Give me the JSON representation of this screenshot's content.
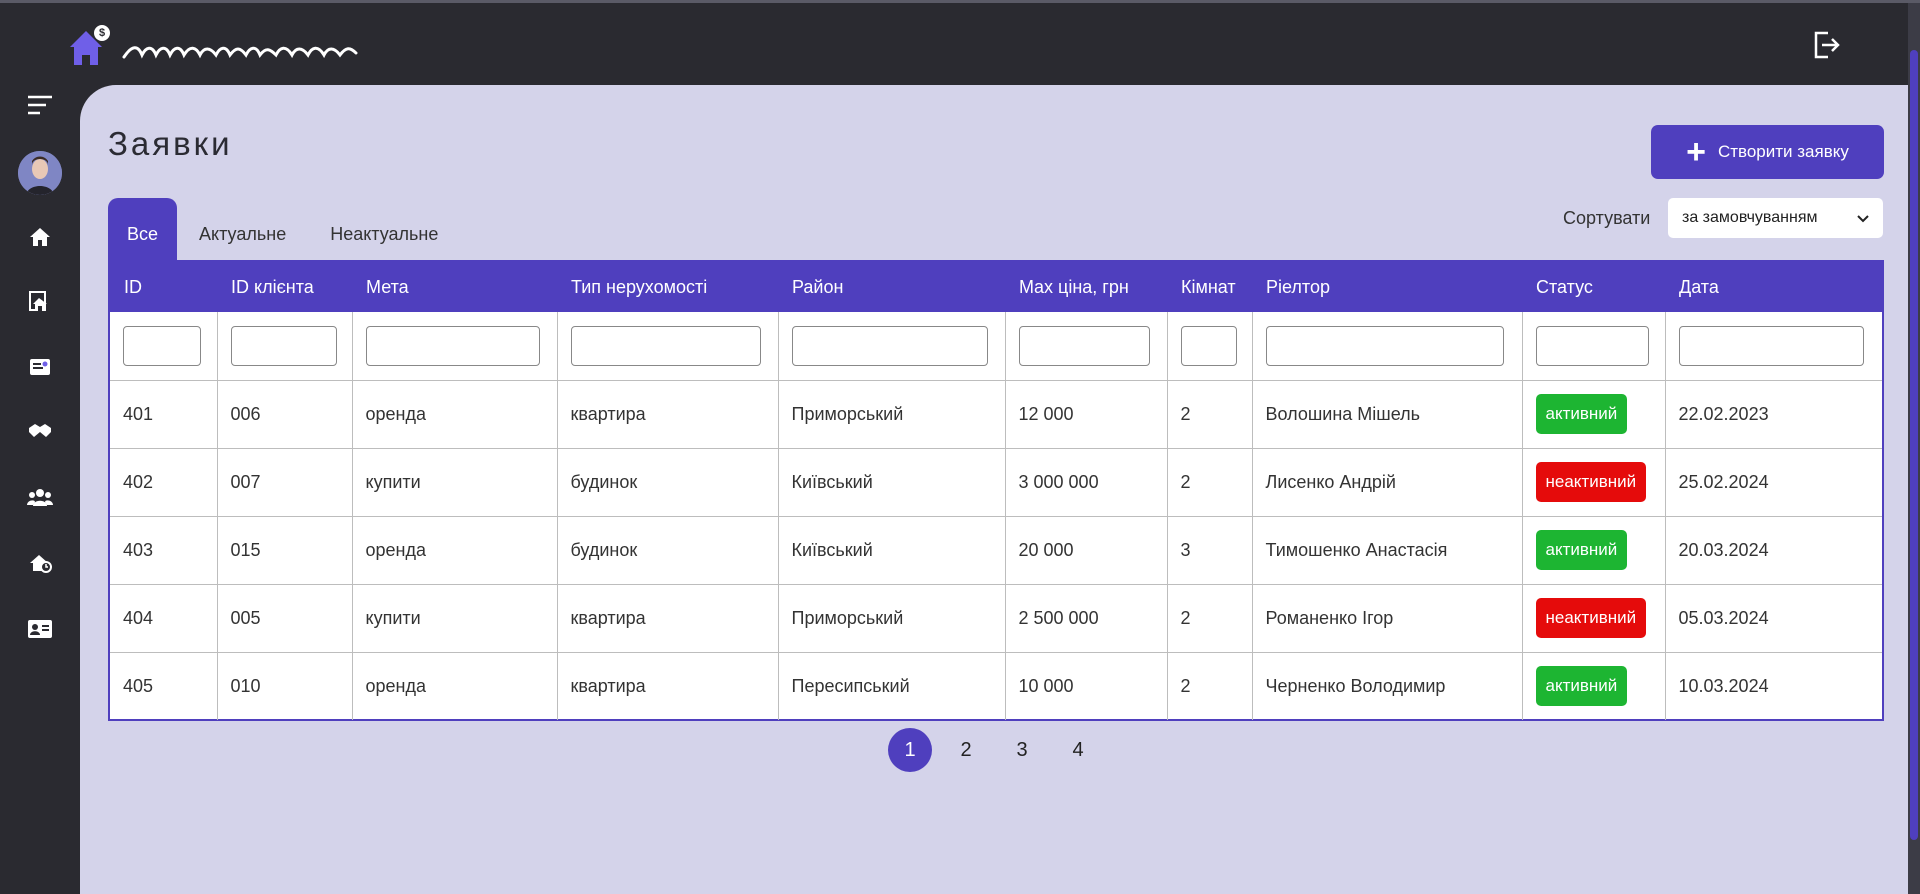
{
  "header": {
    "logo_badge": "$",
    "logout_icon": "logout-icon"
  },
  "sidebar": {
    "items": [
      {
        "icon": "menu-icon"
      },
      {
        "icon": "avatar"
      },
      {
        "icon": "home-icon"
      },
      {
        "icon": "property-icon"
      },
      {
        "icon": "card-icon"
      },
      {
        "icon": "handshake-icon"
      },
      {
        "icon": "users-icon"
      },
      {
        "icon": "realtor-icon"
      },
      {
        "icon": "contact-card-icon"
      }
    ]
  },
  "main": {
    "title": "Заявки",
    "create_button": "Створити заявку",
    "tabs": [
      {
        "label": "Все",
        "active": true
      },
      {
        "label": "Актуальне",
        "active": false
      },
      {
        "label": "Неактуальне",
        "active": false
      }
    ],
    "sort_label": "Сортувати",
    "sort_value": "за замовчуванням"
  },
  "table": {
    "columns": [
      "ID",
      "ID клієнта",
      "Мета",
      "Тип нерухомості",
      "Район",
      "Max ціна, грн",
      "Кімнат",
      "Ріелтор",
      "Статус",
      "Дата"
    ],
    "rows": [
      [
        "401",
        "006",
        "оренда",
        "квартира",
        "Приморський",
        "12 000",
        "2",
        "Волошина Мішель",
        "активний",
        "22.02.2023"
      ],
      [
        "402",
        "007",
        "купити",
        "будинок",
        "Київський",
        "3 000 000",
        "2",
        "Лисенко Андрій",
        "неактивний",
        "25.02.2024"
      ],
      [
        "403",
        "015",
        "оренда",
        "будинок",
        "Київський",
        "20 000",
        "3",
        "Тимошенко Анастасія",
        "активний",
        "20.03.2024"
      ],
      [
        "404",
        "005",
        "купити",
        "квартира",
        "Приморський",
        "2 500 000",
        "2",
        "Романенко Ігор",
        "неактивний",
        "05.03.2024"
      ],
      [
        "405",
        "010",
        "оренда",
        "квартира",
        "Пересипський",
        "10 000",
        "2",
        "Черненко Володимир",
        "активний",
        "10.03.2024"
      ]
    ],
    "status_colors": {
      "активний": "#1db532",
      "неактивний": "#e50b0b"
    }
  },
  "pagination": {
    "pages": [
      "1",
      "2",
      "3",
      "4"
    ],
    "current": "1"
  },
  "colors": {
    "accent": "#4f3fbe",
    "background": "#d4d3ea",
    "chrome": "#2a2a30"
  }
}
